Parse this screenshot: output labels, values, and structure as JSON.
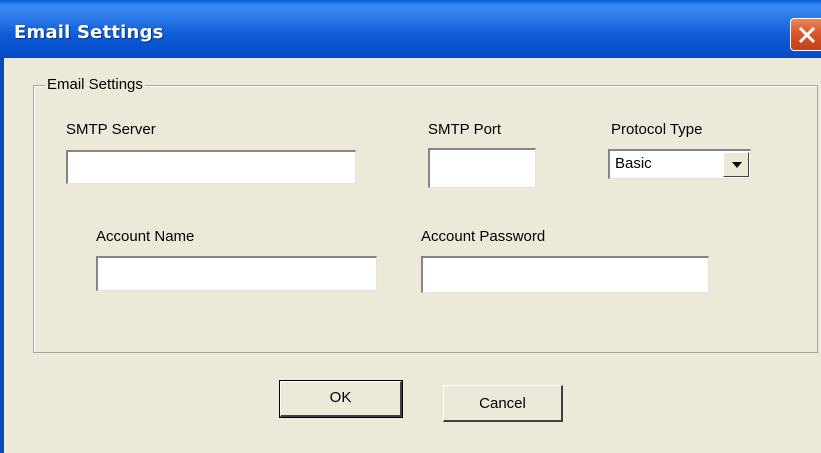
{
  "window": {
    "title": "Email Settings"
  },
  "group": {
    "caption": "Email Settings"
  },
  "fields": {
    "smtp_server": {
      "label": "SMTP Server",
      "value": ""
    },
    "smtp_port": {
      "label": "SMTP Port",
      "value": ""
    },
    "protocol_type": {
      "label": "Protocol Type",
      "selected": "Basic"
    },
    "account_name": {
      "label": "Account Name",
      "value": ""
    },
    "account_password": {
      "label": "Account Password",
      "value": ""
    }
  },
  "buttons": {
    "ok": "OK",
    "cancel": "Cancel"
  },
  "icons": {
    "close": "close-icon",
    "dropdown": "chevron-down-icon"
  },
  "colors": {
    "titlebar": "#0A5FD8",
    "dialog_bg": "#ECE9D8",
    "close_button": "#D9572B"
  }
}
